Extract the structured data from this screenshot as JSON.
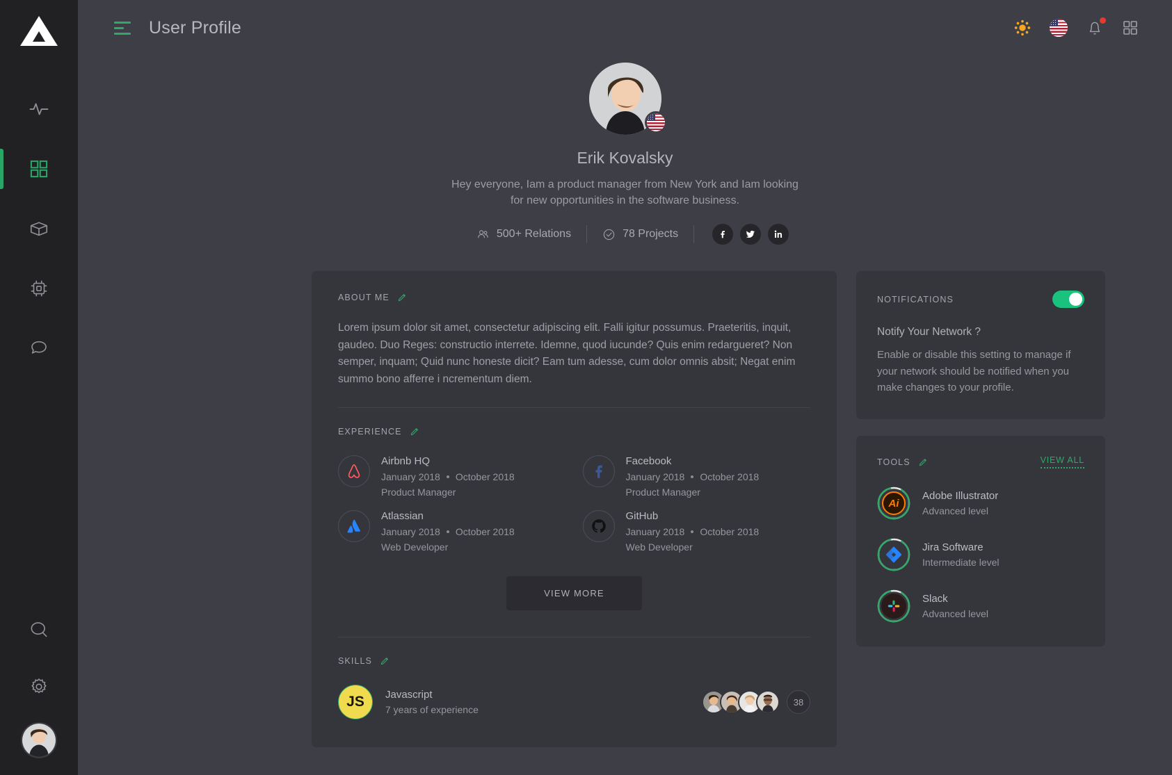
{
  "sidebar": {
    "logo_name": "triangle-logo",
    "items": [
      {
        "icon": "activity-icon",
        "name": "sidebar-item-activity",
        "active": false
      },
      {
        "icon": "grid-icon",
        "name": "sidebar-item-dashboard",
        "active": true
      },
      {
        "icon": "box-icon",
        "name": "sidebar-item-packages",
        "active": false
      },
      {
        "icon": "chip-icon",
        "name": "sidebar-item-devices",
        "active": false
      },
      {
        "icon": "chat-icon",
        "name": "sidebar-item-messages",
        "active": false
      }
    ],
    "bottom_items": [
      {
        "icon": "search-icon",
        "name": "sidebar-item-search"
      },
      {
        "icon": "gear-icon",
        "name": "sidebar-item-settings"
      }
    ],
    "avatar_name": "sidebar-user-avatar"
  },
  "topbar": {
    "menu_icon": "hamburger-icon",
    "title": "User Profile",
    "icons": [
      {
        "name": "brightness-icon",
        "color": "#f5a623"
      },
      {
        "name": "language-flag-icon",
        "label": "US"
      },
      {
        "name": "notifications-bell-icon",
        "badge": true
      },
      {
        "name": "apps-grid-icon"
      }
    ]
  },
  "profile": {
    "name": "Erik Kovalsky",
    "bio": "Hey everyone,  Iam a product manager from New York and Iam looking for new opportunities in the software business.",
    "flag_label": "US",
    "stats": [
      {
        "icon": "people-icon",
        "label": "500+ Relations"
      },
      {
        "icon": "check-circle-icon",
        "label": "78 Projects"
      }
    ],
    "socials": [
      {
        "name": "facebook-icon",
        "label": "f"
      },
      {
        "name": "twitter-icon",
        "label": "t"
      },
      {
        "name": "linkedin-icon",
        "label": "in"
      }
    ]
  },
  "about": {
    "title": "ABOUT ME",
    "edit_icon": "pencil-icon",
    "text": "Lorem ipsum dolor sit amet, consectetur adipiscing elit. Falli igitur possumus. Praeteritis, inquit, gaudeo. Duo Reges: constructio interrete. Idemne, quod iucunde? Quis enim redargueret? Non semper, inquam; Quid nunc honeste dicit? Eam tum adesse, cum dolor omnis absit; Negat enim summo bono afferre i ncrementum diem."
  },
  "experience": {
    "title": "EXPERIENCE",
    "edit_icon": "pencil-icon",
    "items": [
      {
        "company": "Airbnb HQ",
        "icon": "airbnb-logo",
        "start": "January 2018",
        "end": "October 2018",
        "role": "Product Manager"
      },
      {
        "company": "Facebook",
        "icon": "facebook-logo",
        "start": "January 2018",
        "end": "October 2018",
        "role": "Product Manager"
      },
      {
        "company": "Atlassian",
        "icon": "atlassian-logo",
        "start": "January 2018",
        "end": "October 2018",
        "role": "Web Developer"
      },
      {
        "company": "GitHub",
        "icon": "github-logo",
        "start": "January 2018",
        "end": "October 2018",
        "role": "Web Developer"
      }
    ],
    "view_more_label": "VIEW MORE"
  },
  "skills": {
    "title": "SKILLS",
    "edit_icon": "pencil-icon",
    "items": [
      {
        "name": "Javascript",
        "badge": "JS",
        "experience": "7 years of experience",
        "avatar_count": 4,
        "extra_count": "38"
      }
    ]
  },
  "notifications": {
    "title": "NOTIFICATIONS",
    "toggle_on": true,
    "question": "Notify Your Network ?",
    "description": "Enable or disable this setting to manage if your network should be notified when you make changes to your profile."
  },
  "tools": {
    "title": "TOOLS",
    "edit_icon": "pencil-icon",
    "view_all_label": "VIEW ALL",
    "items": [
      {
        "name": "Adobe Illustrator",
        "level": "Advanced level",
        "icon": "adobe-illustrator-logo",
        "progress": 88
      },
      {
        "name": "Jira Software",
        "level": "Intermediate level",
        "icon": "jira-logo",
        "progress": 88
      },
      {
        "name": "Slack",
        "level": "Advanced level",
        "icon": "slack-logo",
        "progress": 88
      }
    ]
  },
  "colors": {
    "accent_green": "#2fa868",
    "toggle_green": "#19c37d",
    "page_bg": "#3e3e46",
    "card_bg": "#35353c",
    "sidebar_bg": "#212124",
    "badge_red": "#e8392f",
    "sun_orange": "#f5a623"
  }
}
